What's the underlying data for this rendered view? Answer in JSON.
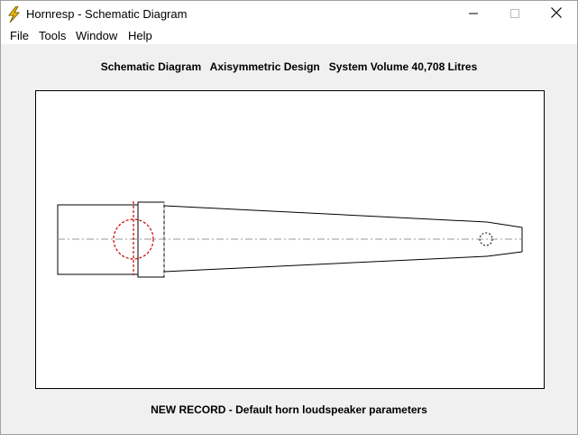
{
  "window": {
    "title": "Hornresp - Schematic Diagram",
    "icon": "lightning-bolt-icon",
    "caption_buttons": [
      "minimize-icon",
      "maximize-icon",
      "close-icon"
    ]
  },
  "menu": {
    "items": [
      {
        "label": "File"
      },
      {
        "label": "Tools"
      },
      {
        "label": "Window"
      },
      {
        "label": "Help"
      }
    ]
  },
  "header": {
    "title": "Schematic Diagram   Axisymmetric Design   System Volume 40,708 Litres"
  },
  "footer": {
    "status": "NEW RECORD - Default horn loudspeaker parameters"
  },
  "colors": {
    "driver_circle": "#cc0000",
    "centerline": "#999999",
    "outline": "#000000",
    "icon_bolt": "#f2c200"
  }
}
